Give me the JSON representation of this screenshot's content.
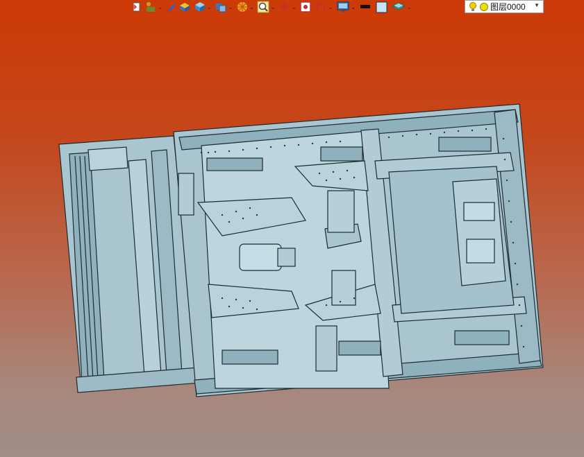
{
  "toolbar": {
    "items": [
      {
        "icon": "insert-icon"
      },
      {
        "icon": "assembly-icon",
        "dropdown": true
      },
      {
        "icon": "pen-icon"
      },
      {
        "icon": "part-block-icon"
      },
      {
        "icon": "solid-cube-icon",
        "dropdown": true
      },
      {
        "icon": "view-cube-icon",
        "dropdown": true
      },
      {
        "icon": "render-sphere-icon",
        "dropdown": true
      },
      {
        "icon": "zoom-icon",
        "dropdown": true
      },
      {
        "icon": "crosshair-icon",
        "dropdown": true
      },
      {
        "icon": "fit-view-icon"
      },
      {
        "icon": "dimension-icon",
        "dropdown": true
      },
      {
        "icon": "display-icon",
        "dropdown": true
      },
      {
        "icon": "line-color-icon"
      },
      {
        "icon": "fill-color-icon"
      },
      {
        "icon": "layer-stack-icon",
        "dropdown": true
      }
    ]
  },
  "layer": {
    "label": "图层0000",
    "colors": {
      "bulb": "#f5d000",
      "dot": "#e8e000"
    }
  },
  "model": {
    "name": "frame-assembly",
    "colors": {
      "body": "#a9c6d0",
      "edge": "#1d2a30",
      "shade": "#8fb1bd"
    }
  },
  "background": {
    "top": "#cc3a06",
    "bottom": "#a08e88"
  }
}
